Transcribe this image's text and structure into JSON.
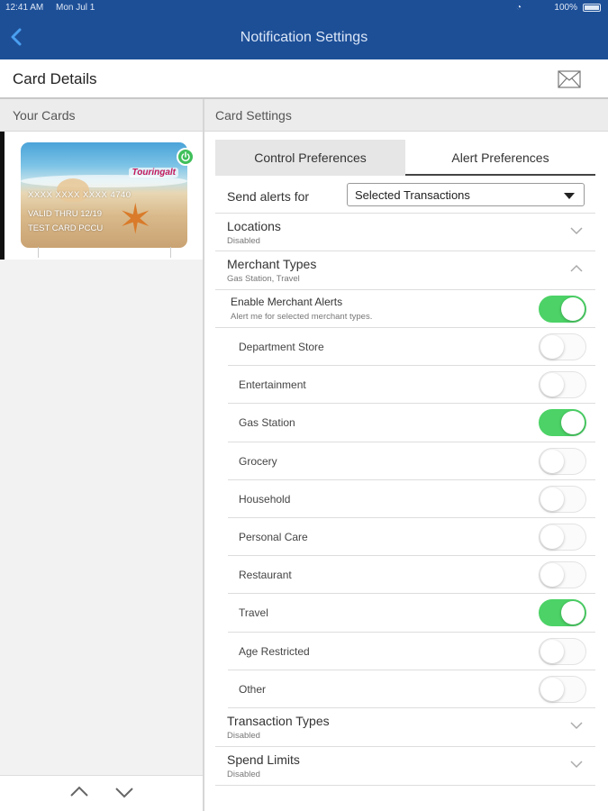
{
  "status_bar": {
    "time": "12:41 AM",
    "date": "Mon Jul 1",
    "battery": "100%"
  },
  "nav": {
    "title": "Notification Settings"
  },
  "card_details": {
    "title": "Card Details"
  },
  "left": {
    "header": "Your Cards",
    "card": {
      "brand": "Touringalt",
      "number": "XXXX XXXX XXXX 4740",
      "valid": "VALID THRU 12/19",
      "name": "TEST CARD PCCU"
    }
  },
  "right": {
    "header": "Card Settings",
    "tabs": {
      "control": "Control Preferences",
      "alert": "Alert Preferences"
    },
    "send_alerts": {
      "label": "Send alerts for",
      "value": "Selected Transactions"
    },
    "locations": {
      "title": "Locations",
      "sub": "Disabled"
    },
    "merchant_types": {
      "title": "Merchant Types",
      "sub": "Gas Station, Travel"
    },
    "enable": {
      "title": "Enable Merchant Alerts",
      "sub": "Alert me for selected merchant types.",
      "on": true
    },
    "merchants": [
      {
        "label": "Department Store",
        "on": false
      },
      {
        "label": "Entertainment",
        "on": false
      },
      {
        "label": "Gas Station",
        "on": true
      },
      {
        "label": "Grocery",
        "on": false
      },
      {
        "label": "Household",
        "on": false
      },
      {
        "label": "Personal Care",
        "on": false
      },
      {
        "label": "Restaurant",
        "on": false
      },
      {
        "label": "Travel",
        "on": true
      },
      {
        "label": "Age Restricted",
        "on": false
      },
      {
        "label": "Other",
        "on": false
      }
    ],
    "transaction_types": {
      "title": "Transaction Types",
      "sub": "Disabled"
    },
    "spend_limits": {
      "title": "Spend Limits",
      "sub": "Disabled"
    }
  },
  "colors": {
    "nav": "#1d4f97",
    "toggle_on": "#4cd266",
    "power": "#3fbf5a"
  }
}
